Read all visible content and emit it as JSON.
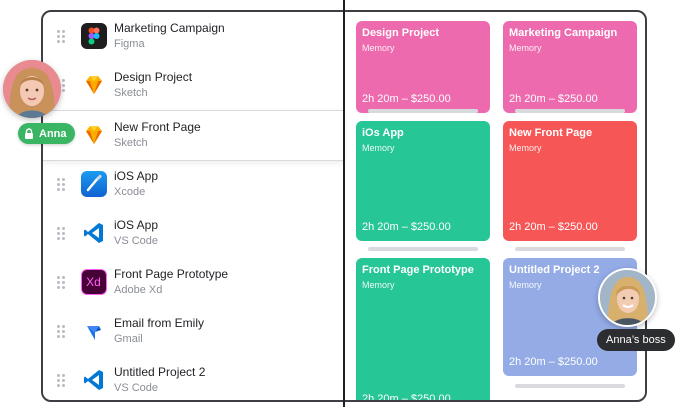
{
  "list_items": [
    {
      "title": "Marketing Campaign",
      "app": "Figma",
      "icon": "figma-icon"
    },
    {
      "title": "Design Project",
      "app": "Sketch",
      "icon": "sketch-icon"
    },
    {
      "title": "New Front Page",
      "app": "Sketch",
      "icon": "sketch-icon"
    },
    {
      "title": "iOS App",
      "app": "Xcode",
      "icon": "xcode-icon"
    },
    {
      "title": "iOS App",
      "app": "VS Code",
      "icon": "vscode-icon"
    },
    {
      "title": "Front Page Prototype",
      "app": "Adobe Xd",
      "icon": "adobe-xd-icon"
    },
    {
      "title": "Email from Emily",
      "app": "Gmail",
      "icon": "gmail-icon"
    },
    {
      "title": "Untitled Project 2",
      "app": "VS Code",
      "icon": "vscode-icon"
    }
  ],
  "cards": [
    {
      "title": "Design Project",
      "subtitle": "Memory",
      "price": "2h 20m – $250.00",
      "color": "#ee6aae"
    },
    {
      "title": "Marketing Campaign",
      "subtitle": "Memory",
      "price": "2h 20m – $250.00",
      "color": "#ee6aae"
    },
    {
      "title": "iOs App",
      "subtitle": "Memory",
      "price": "2h 20m – $250.00",
      "color": "#27c697"
    },
    {
      "title": "New Front Page",
      "subtitle": "Memory",
      "price": "2h 20m – $250.00",
      "color": "#f65656"
    },
    {
      "title": "Front Page Prototype",
      "subtitle": "Memory",
      "price": "2h 20m – $250.00",
      "color": "#27c697"
    },
    {
      "title": "Untitled Project 2",
      "subtitle": "Memory",
      "price": "2h 20m – $250.00",
      "color": "#94abe6"
    }
  ],
  "collaborators": {
    "anna_label": "Anna",
    "boss_label": "Anna’s boss"
  },
  "colors": {
    "anna_badge": "#39b564",
    "boss_badge": "#2c2d31",
    "frame_border": "#3d3f44"
  }
}
